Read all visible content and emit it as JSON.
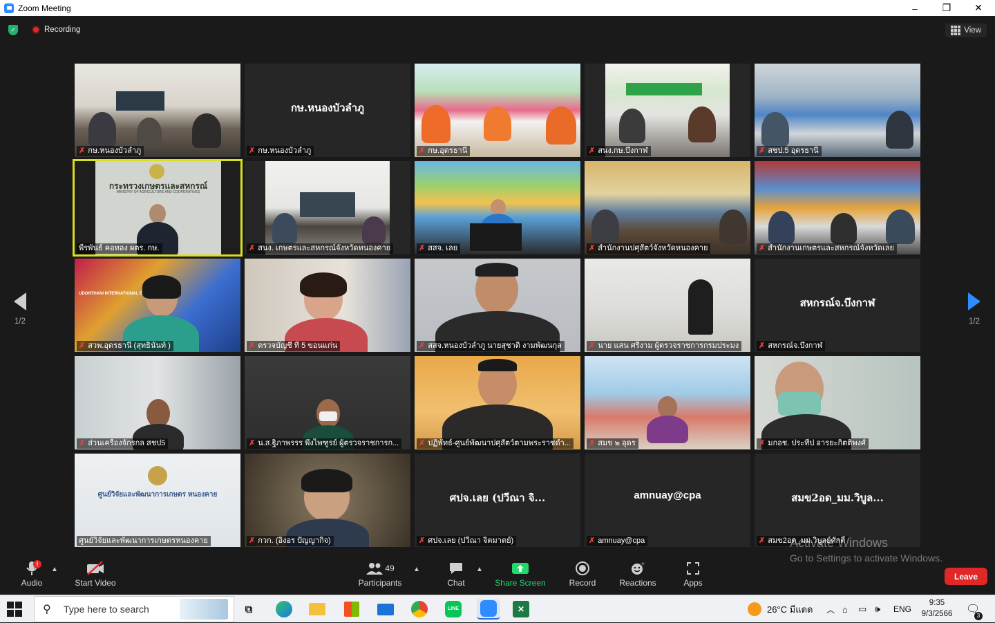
{
  "window": {
    "title": "Zoom Meeting",
    "controls": [
      "–",
      "❐",
      "✕"
    ]
  },
  "meeting": {
    "recording_label": "Recording",
    "view_label": "View",
    "pager_left": "1/2",
    "pager_right": "1/2"
  },
  "tiles": [
    {
      "name": "กษ.หนองบัวลำภู",
      "muted": true
    },
    {
      "name": "กษ.หนองบัวลำภู",
      "muted": true,
      "big_name": "กษ.หนองบัวลำภู"
    },
    {
      "name": "กษ.อุดรธานี",
      "muted": true
    },
    {
      "name": "สนง.กษ.บึงกาฬ",
      "muted": true
    },
    {
      "name": "สชป.5 อุดรธานี",
      "muted": true
    },
    {
      "name": "พีรพันธ์ คอทอง ผตร. กษ.",
      "muted": false,
      "active_speaker": true,
      "sign": "กระทรวงเกษตรและสหกรณ์",
      "sign_sub": "MINISTRY OF AGRICULTURE AND COOPERATIVES"
    },
    {
      "name": "สนง. เกษตรและสหกรณ์จังหวัดหนองคาย",
      "muted": true
    },
    {
      "name": "สสจ. เลย",
      "muted": true
    },
    {
      "name": "สำนักงานปศุสัตว์จังหวัดหนองคาย",
      "muted": true
    },
    {
      "name": "สำนักงานเกษตรและสหกรณ์จังหวัดเลย",
      "muted": true
    },
    {
      "name": "สวพ.อุดรธานี (สุทธินันท์ )",
      "muted": true,
      "banner": "UDONTHANI INTERNATIONAL EXPO 2026"
    },
    {
      "name": "ตรวจบัญชี ที่ 5 ขอนแก่น",
      "muted": true
    },
    {
      "name": "สสจ.หนองบัวลำภู นายสุชาติ งามพัฒนกุล",
      "muted": true
    },
    {
      "name": "นาย แสน ศรีงาม ผู้ตรวจราชการกรมประมง",
      "muted": true
    },
    {
      "name": "สหกรณ์จ.บึงกาฬ",
      "muted": true,
      "big_name": "สหกรณ์จ.บึงกาฬ"
    },
    {
      "name": "ส่วนเครื่องจักรกล สชป5",
      "muted": true
    },
    {
      "name": "น.ส.ฐิภาพรรร พึ่งไพฑูรย์ ผู้ตรวจราชการก...",
      "muted": true
    },
    {
      "name": "ปฏิพัทธ์-ศูนย์พัฒนาปศุสัตว์ตามพระราชดำ...",
      "muted": true
    },
    {
      "name": "สมข ๒ อุดร",
      "muted": true
    },
    {
      "name": "มกอช. ประทีป อารยะกิตติพงศ์",
      "muted": true
    },
    {
      "name": "ศูนย์วิจัยและพัฒนาการเกษตรหนองคาย",
      "muted": false,
      "sign": "ศูนย์วิจัยและพัฒนาการเกษตร หนองคาย"
    },
    {
      "name": "กวก. (อิงอร ปัญญากิจ)",
      "muted": true
    },
    {
      "name": "ศปจ.เลย (ปวีณา จิตมาตย์)",
      "muted": true,
      "big_name": "ศปจ.เลย (ปวีณา จิ..."
    },
    {
      "name": "amnuay@cpa",
      "muted": true,
      "big_name": "amnuay@cpa"
    },
    {
      "name": "สมข2อด_มม.วิบูลย์ศักดิ์",
      "muted": true,
      "big_name": "สมข2อด_มม.วิบูล..."
    }
  ],
  "toolbar": {
    "audio": "Audio",
    "start_video": "Start Video",
    "participants": "Participants",
    "participants_count": "49",
    "chat": "Chat",
    "share_screen": "Share Screen",
    "record": "Record",
    "reactions": "Reactions",
    "apps": "Apps",
    "leave": "Leave",
    "audio_badge": "!"
  },
  "watermark": {
    "line1": "Activate Windows",
    "line2": "Go to Settings to activate Windows."
  },
  "taskbar": {
    "search_placeholder": "Type here to search",
    "weather": "26°C มีแดด",
    "language": "ENG",
    "time": "9:35",
    "date": "9/3/2566",
    "notification_count": "3"
  }
}
